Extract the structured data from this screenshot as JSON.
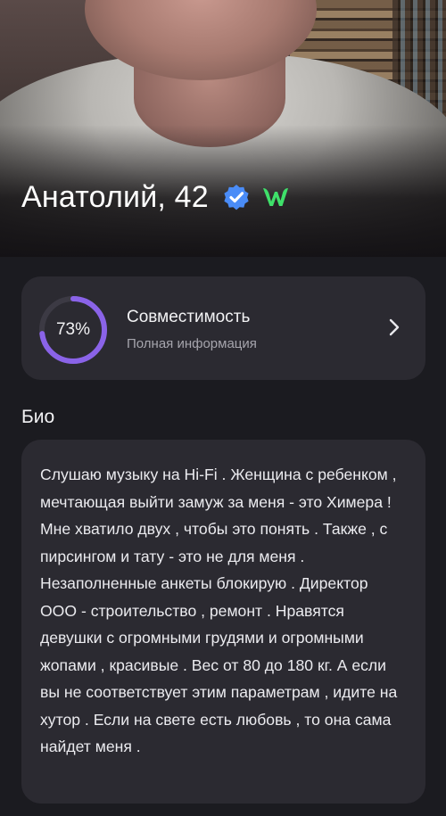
{
  "profile": {
    "name_age": "Анатолий, 42",
    "verified_icon": "verified-badge-icon",
    "brand_icon": "w-logo-icon",
    "colors": {
      "verified": "#4a8cf7",
      "brand": "#3fe06a"
    }
  },
  "compatibility": {
    "percent": 73,
    "percent_label": "73%",
    "title": "Совместимость",
    "subtitle": "Полная информация",
    "colors": {
      "ring": "#8a63e8",
      "ring_track": "#3c3a44"
    }
  },
  "bio": {
    "heading": "Био",
    "text": "Слушаю музыку на Hi-Fi . Женщина с ребенком , мечтающая выйти замуж за меня - это Химера !  Мне хватило двух , чтобы это понять . Также , с пирсингом и тату - это не для меня . Незаполненные анкеты блокирую . Директор ООО - строительство , ремонт . Нравятся девушки с огромными грудями и огромными жопами , красивые . Вес от 80 до 180 кг. А если вы не соответствует этим параметрам , идите на хутор . Если на свете есть любовь , то она сама найдет меня ."
  }
}
